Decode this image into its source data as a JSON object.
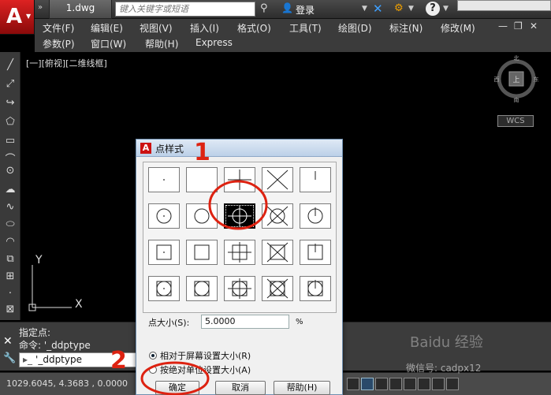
{
  "titlebar": {
    "doc_tab": "1.dwg",
    "search_placeholder": "键入关键字或短语",
    "login_label": "登录"
  },
  "menu": {
    "row1": [
      "文件(F)",
      "编辑(E)",
      "视图(V)",
      "插入(I)",
      "格式(O)",
      "工具(T)",
      "绘图(D)",
      "标注(N)",
      "修改(M)"
    ],
    "row2": [
      "参数(P)",
      "窗口(W)",
      "帮助(H)",
      "Express"
    ]
  },
  "canvas": {
    "viewport_label": "[一][俯视][二维线框]",
    "viewcube": {
      "north": "北",
      "south": "南",
      "west": "西",
      "east": "东",
      "face": "上"
    },
    "wcs_label": "WCS",
    "ucs_y": "Y",
    "ucs_x": "X"
  },
  "command": {
    "history": [
      "指定点:",
      "命令:  '_ddptype"
    ],
    "input_value": "'_ddptype"
  },
  "statusbar": {
    "coords": "1029.6045, 4.3683 , 0.0000"
  },
  "dialog": {
    "title": "点样式",
    "size_label": "点大小(S):",
    "size_value": "5.0000",
    "size_unit": "%",
    "radio_relative": "相对于屏幕设置大小(R)",
    "radio_absolute": "按绝对单位设置大小(A)",
    "btn_ok": "确定",
    "btn_cancel": "取消",
    "btn_help": "帮助(H)",
    "selected_style": "row 2, column 3"
  },
  "annotations": {
    "mark_1": "1",
    "mark_2": "2"
  },
  "watermark": {
    "text": "Baidu 经验",
    "sub": "微信号: cadpx12"
  }
}
